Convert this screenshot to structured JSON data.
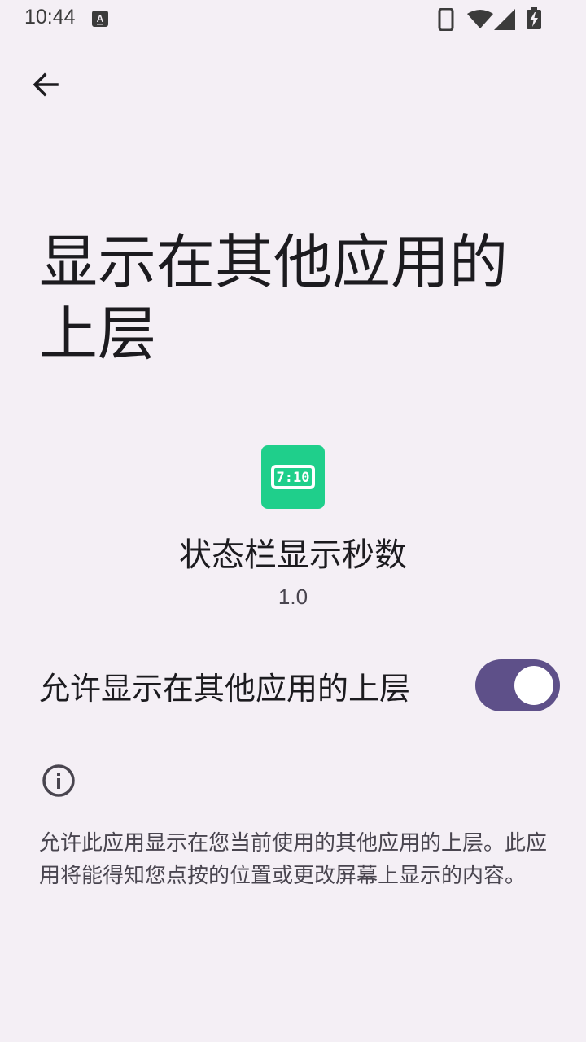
{
  "status_bar": {
    "time": "10:44",
    "icons": [
      "a-notification-icon",
      "phone-icon",
      "wifi-icon",
      "signal-icon",
      "battery-charging-icon"
    ]
  },
  "header": {
    "back_icon": "arrow-back-icon"
  },
  "title": "显示在其他应用的上层",
  "app": {
    "name": "状态栏显示秒数",
    "version": "1.0",
    "icon_text": "7:10",
    "icon_color": "#1fcf8b"
  },
  "permission_toggle": {
    "label": "允许显示在其他应用的上层",
    "enabled": true,
    "track_color": "#5e5089"
  },
  "info": {
    "icon": "info-icon",
    "text": "允许此应用显示在您当前使用的其他应用的上层。此应用将能得知您点按的位置或更改屏幕上显示的内容。"
  },
  "colors": {
    "background": "#f4eff5",
    "accent": "#5e5089"
  }
}
